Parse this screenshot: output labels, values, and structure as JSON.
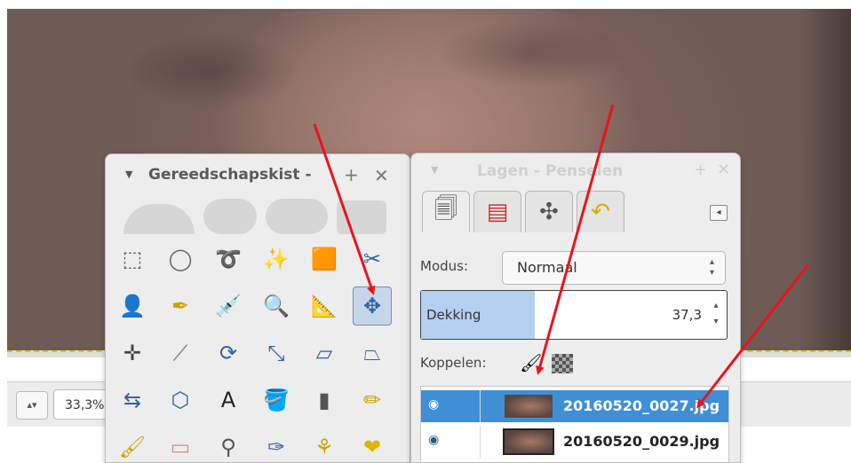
{
  "zoom": {
    "value": "33,3%"
  },
  "toolbox": {
    "title": "Gereedschapskist - ",
    "tools": [
      {
        "name": "rect-select-icon",
        "glyph": "⬚",
        "color": "#555"
      },
      {
        "name": "ellipse-select-icon",
        "glyph": "◯",
        "color": "#666"
      },
      {
        "name": "free-select-icon",
        "glyph": "➰",
        "color": "#777"
      },
      {
        "name": "fuzzy-select-icon",
        "glyph": "✨",
        "color": "#c9a400"
      },
      {
        "name": "select-by-color-icon",
        "glyph": "🟧",
        "color": "#d37a00"
      },
      {
        "name": "scissors-select-icon",
        "glyph": "✂",
        "color": "#2f62a8"
      },
      {
        "name": "foreground-select-icon",
        "glyph": "👤",
        "color": "#2f62a8"
      },
      {
        "name": "paths-icon",
        "glyph": "✒",
        "color": "#c9a400"
      },
      {
        "name": "color-picker-icon",
        "glyph": "💉",
        "color": "#2f62a8"
      },
      {
        "name": "zoom-icon",
        "glyph": "🔍",
        "color": "#6a8fb8"
      },
      {
        "name": "measure-icon",
        "glyph": "📐",
        "color": "#555"
      },
      {
        "name": "move-icon",
        "glyph": "✥",
        "color": "#2f62a8"
      },
      {
        "name": "align-icon",
        "glyph": "✛",
        "color": "#444"
      },
      {
        "name": "crop-icon",
        "glyph": "⟋",
        "color": "#777"
      },
      {
        "name": "rotate-icon",
        "glyph": "⟳",
        "color": "#2f62a8"
      },
      {
        "name": "scale-icon",
        "glyph": "⤡",
        "color": "#2f62a8"
      },
      {
        "name": "shear-icon",
        "glyph": "▱",
        "color": "#2f62a8"
      },
      {
        "name": "perspective-icon",
        "glyph": "⏢",
        "color": "#2f62a8"
      },
      {
        "name": "flip-icon",
        "glyph": "⇆",
        "color": "#2f62a8"
      },
      {
        "name": "cage-transform-icon",
        "glyph": "⬡",
        "color": "#2f62a8"
      },
      {
        "name": "text-icon",
        "glyph": "A",
        "color": "#222"
      },
      {
        "name": "bucket-fill-icon",
        "glyph": "🪣",
        "color": "#777"
      },
      {
        "name": "blend-icon",
        "glyph": "▮",
        "color": "#555"
      },
      {
        "name": "pencil-icon",
        "glyph": "✏",
        "color": "#c9a400"
      },
      {
        "name": "paintbrush-icon",
        "glyph": "🖌",
        "color": "#c9a400"
      },
      {
        "name": "eraser-icon",
        "glyph": "▭",
        "color": "#d98a8a"
      },
      {
        "name": "airbrush-icon",
        "glyph": "⚲",
        "color": "#555"
      },
      {
        "name": "ink-icon",
        "glyph": "✑",
        "color": "#2f62a8"
      },
      {
        "name": "clone-icon",
        "glyph": "⚘",
        "color": "#c9a400"
      },
      {
        "name": "heal-icon",
        "glyph": "❤",
        "color": "#e0b400"
      }
    ]
  },
  "layers_panel": {
    "title": "Lagen - Penselen",
    "tabs": [
      {
        "name": "tab-layers",
        "glyph": "🗐",
        "color": "#444"
      },
      {
        "name": "tab-channels",
        "glyph": "▤",
        "color": "#d62b2b"
      },
      {
        "name": "tab-paths",
        "glyph": "✣",
        "color": "#555"
      },
      {
        "name": "tab-undo",
        "glyph": "↶",
        "color": "#e0a800"
      }
    ],
    "mode_label": "Modus:",
    "mode_value": "Normaal",
    "opacity_label": "Dekking",
    "opacity_value": "37,3",
    "opacity_fraction": 0.373,
    "lock_label": "Koppelen:",
    "layers": [
      {
        "name": "20160520_0027.jpg",
        "selected": true
      },
      {
        "name": "20160520_0029.jpg",
        "selected": false
      }
    ]
  },
  "annotation_color": "#e8141c"
}
